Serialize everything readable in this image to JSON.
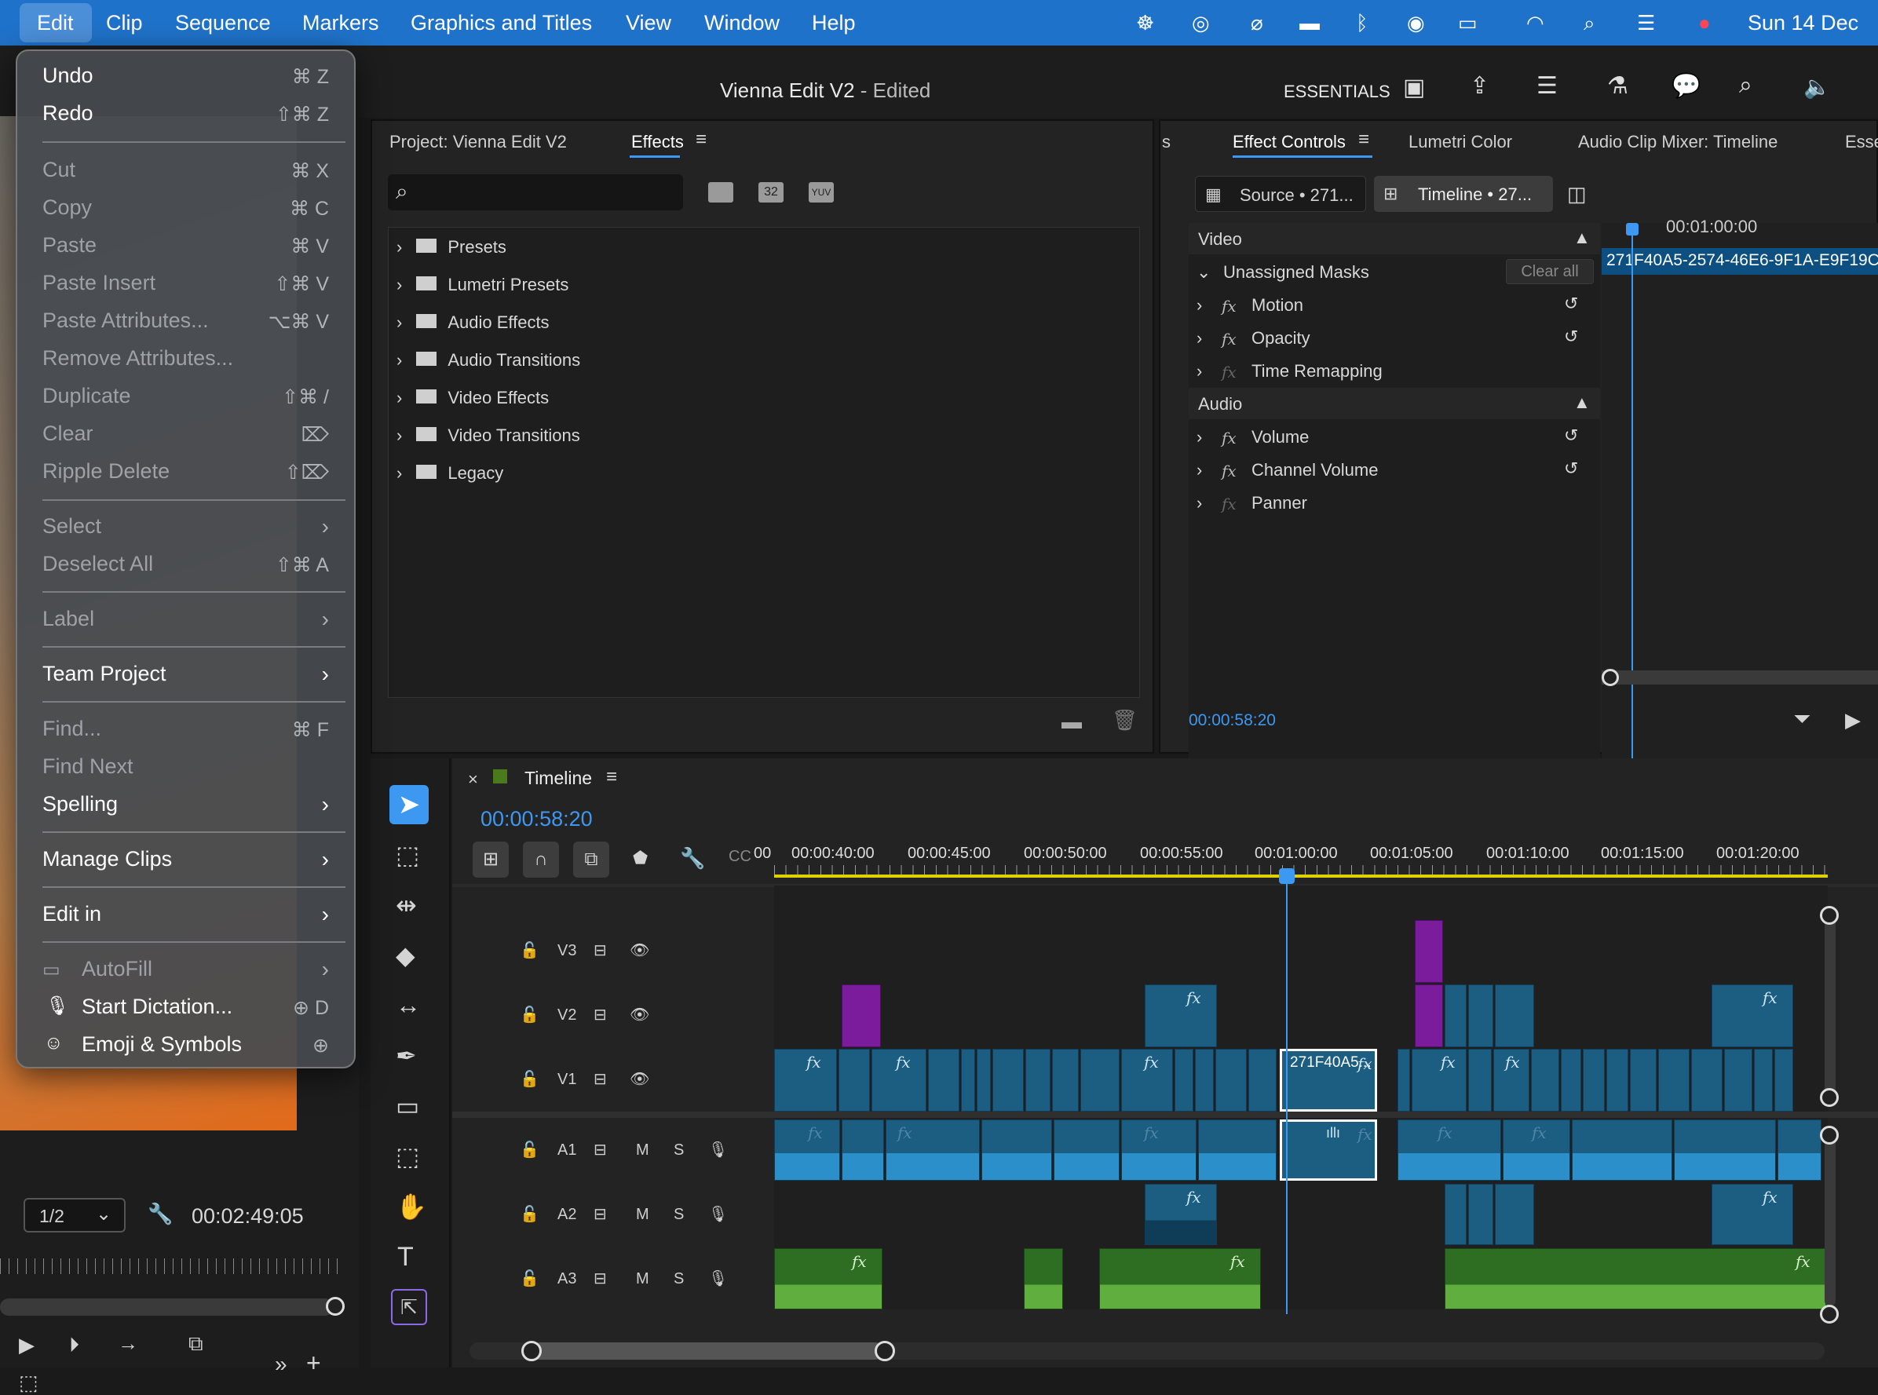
{
  "menubar": {
    "items": [
      "Edit",
      "Clip",
      "Sequence",
      "Markers",
      "Graphics and Titles",
      "View",
      "Window",
      "Help"
    ],
    "datetime": "Sun 14 Dec"
  },
  "edit_menu": {
    "items": [
      {
        "label": "Undo",
        "shortcut": "⌘ Z",
        "enabled": true
      },
      {
        "label": "Redo",
        "shortcut": "⇧⌘ Z",
        "enabled": true
      },
      {
        "label": "Cut",
        "shortcut": "⌘ X",
        "enabled": false
      },
      {
        "label": "Copy",
        "shortcut": "⌘ C",
        "enabled": false
      },
      {
        "label": "Paste",
        "shortcut": "⌘ V",
        "enabled": false
      },
      {
        "label": "Paste Insert",
        "shortcut": "⇧⌘ V",
        "enabled": false
      },
      {
        "label": "Paste Attributes...",
        "shortcut": "⌥⌘ V",
        "enabled": false
      },
      {
        "label": "Remove Attributes...",
        "shortcut": "",
        "enabled": false
      },
      {
        "label": "Duplicate",
        "shortcut": "⇧⌘ /",
        "enabled": false
      },
      {
        "label": "Clear",
        "shortcut": "⌦",
        "enabled": false
      },
      {
        "label": "Ripple Delete",
        "shortcut": "⇧⌦",
        "enabled": false
      },
      {
        "label": "Select",
        "shortcut": "›",
        "enabled": false
      },
      {
        "label": "Deselect All",
        "shortcut": "⇧⌘ A",
        "enabled": false
      },
      {
        "label": "Label",
        "shortcut": "›",
        "enabled": false
      },
      {
        "label": "Team Project",
        "shortcut": "›",
        "enabled": true
      },
      {
        "label": "Find...",
        "shortcut": "⌘ F",
        "enabled": false
      },
      {
        "label": "Find Next",
        "shortcut": "",
        "enabled": false
      },
      {
        "label": "Spelling",
        "shortcut": "›",
        "enabled": true
      },
      {
        "label": "Manage Clips",
        "shortcut": "›",
        "enabled": true
      },
      {
        "label": "Edit in",
        "shortcut": "›",
        "enabled": true
      },
      {
        "label": "AutoFill",
        "shortcut": "›",
        "enabled": false
      },
      {
        "label": "Start Dictation...",
        "shortcut": "D",
        "enabled": true
      },
      {
        "label": "Emoji & Symbols",
        "shortcut": "",
        "enabled": true
      }
    ]
  },
  "appbar": {
    "title": "Vienna Edit V2",
    "title_suffix": " - Edited",
    "workspace": "ESSENTIALS"
  },
  "project_panel": {
    "tab_project": "Project: Vienna Edit V2",
    "tab_effects": "Effects",
    "search_placeholder": "",
    "folders": [
      "Presets",
      "Lumetri Presets",
      "Audio Effects",
      "Audio Transitions",
      "Video Effects",
      "Video Transitions",
      "Legacy"
    ],
    "badge_32": "32",
    "badge_yuv": "YUV"
  },
  "effect_controls": {
    "tab_prev": "s",
    "tabs": [
      "Effect Controls",
      "Lumetri Color",
      "Audio Clip Mixer: Timeline",
      "Esse"
    ],
    "source_label": "Source • 271...",
    "timeline_label": "Timeline • 27...",
    "ruler_time": "00:01:00:00",
    "clip_name": "271F40A5-2574-46E6-9F1A-E9F19C",
    "video_header": "Video",
    "audio_header": "Audio",
    "masks_label": "Unassigned Masks",
    "clear_all": "Clear all",
    "video_effects": [
      "Motion",
      "Opacity",
      "Time Remapping"
    ],
    "audio_effects": [
      "Volume",
      "Channel Volume",
      "Panner"
    ],
    "timecode": "00:00:58:20"
  },
  "source_monitor": {
    "resolution": "1/2",
    "timecode": "00:02:49:05"
  },
  "timeline": {
    "title": "Timeline",
    "timecode": "00:00:58:20",
    "ruler_partial": "00",
    "ruler_labels": [
      "00:00:40:00",
      "00:00:45:00",
      "00:00:50:00",
      "00:00:55:00",
      "00:01:00:00",
      "00:01:05:00",
      "00:01:10:00",
      "00:01:15:00",
      "00:01:20:00"
    ],
    "tracks": [
      {
        "name": "V3",
        "type": "video"
      },
      {
        "name": "V2",
        "type": "video"
      },
      {
        "name": "V1",
        "type": "video"
      },
      {
        "name": "A1",
        "type": "audio"
      },
      {
        "name": "A2",
        "type": "audio"
      },
      {
        "name": "A3",
        "type": "audio"
      }
    ],
    "selected_clip_name": "271F40A5...",
    "mute_label": "M",
    "solo_label": "S",
    "fx_label": "fx"
  },
  "colors": {
    "menubar": "#1f72c9",
    "accent_blue": "#3d98f2",
    "playhead": "#3d98f2",
    "video_clip": "#1c5d82",
    "audio_clip_green": "#2e6e22",
    "purple_clip": "#7a1c9c",
    "work_area": "#e0d100"
  }
}
